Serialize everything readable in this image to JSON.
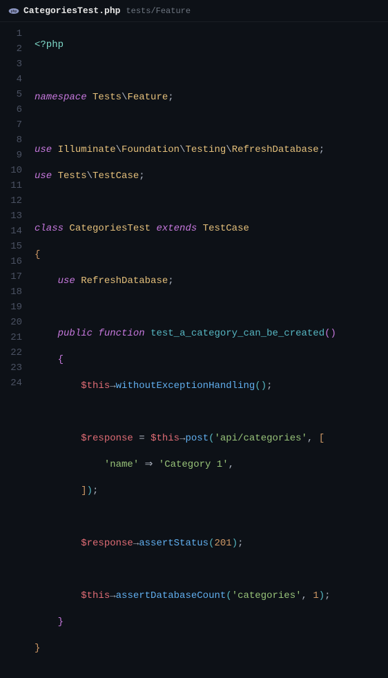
{
  "tab": {
    "filename": "CategoriesTest.php",
    "path": "tests/Feature",
    "icon": "php-icon"
  },
  "code": {
    "open_tag": "<?php",
    "namespace_kw": "namespace",
    "namespace_path": [
      "Tests",
      "Feature"
    ],
    "use_kw": "use",
    "use1": [
      "Illuminate",
      "Foundation",
      "Testing",
      "RefreshDatabase"
    ],
    "use2": [
      "Tests",
      "TestCase"
    ],
    "class_kw": "class",
    "class_name": "CategoriesTest",
    "extends_kw": "extends",
    "extends_name": "TestCase",
    "trait_name": "RefreshDatabase",
    "public_kw": "public",
    "function_kw": "function",
    "method_name": "test_a_category_can_be_created",
    "this": "$this",
    "response": "$response",
    "m_withoutExceptionHandling": "withoutExceptionHandling",
    "m_post": "post",
    "s_api_categories": "'api/categories'",
    "s_name": "'name'",
    "s_category1": "'Category 1'",
    "m_assertStatus": "assertStatus",
    "n_201": "201",
    "m_assertDatabaseCount": "assertDatabaseCount",
    "s_categories": "'categories'",
    "n_1": "1",
    "semicolon": ";",
    "comma": ",",
    "eq": " = ",
    "arrow": "→",
    "fat_arrow": " ⇒ ",
    "open_brace": "{",
    "close_brace": "}",
    "open_paren": "(",
    "close_paren": ")",
    "open_paren2": "(",
    "close_paren2": ")",
    "open_sq": "[",
    "close_sq": "]",
    "ns_sep": "\\"
  },
  "line_numbers": [
    "1",
    "2",
    "3",
    "4",
    "5",
    "6",
    "7",
    "8",
    "9",
    "10",
    "11",
    "12",
    "13",
    "14",
    "15",
    "16",
    "17",
    "18",
    "19",
    "20",
    "21",
    "22",
    "23",
    "24"
  ]
}
